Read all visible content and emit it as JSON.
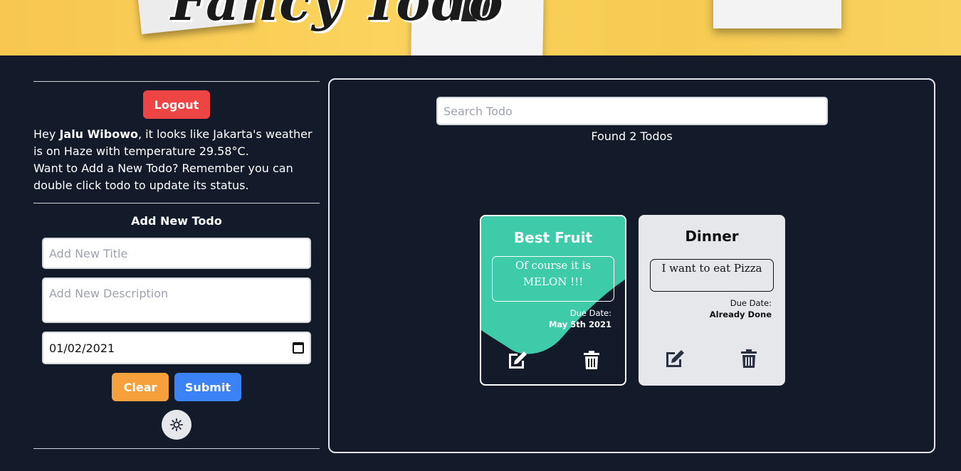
{
  "banner": {
    "title": "Fancy Todo"
  },
  "left": {
    "logout_label": "Logout",
    "greeting": {
      "prefix": "Hey ",
      "user": "Jalu Wibowo",
      "weather_text": ", it looks like Jakarta's weather is on Haze with temperature 29.58°C.",
      "hint": "Want to Add a New Todo? Remember you can double click todo to update its status."
    },
    "add_title": "Add New Todo",
    "form": {
      "title_placeholder": "Add New Title",
      "desc_placeholder": "Add New Description",
      "date_value": "01/02/2021"
    },
    "clear_label": "Clear",
    "submit_label": "Submit",
    "theme_icon": "sun-icon"
  },
  "main": {
    "search_placeholder": "Search Todo",
    "found_text": "Found 2 Todos",
    "todos": [
      {
        "title": "Best Fruit",
        "description": "Of course it is MELON !!!",
        "due_label": "Due Date:",
        "due_value": "May 5th 2021",
        "accent": "#3ecba9"
      },
      {
        "title": "Dinner",
        "description": "I want to eat Pizza",
        "due_label": "Due Date:",
        "due_value": "Already Done",
        "accent": "#e5e7eb"
      }
    ]
  },
  "colors": {
    "background": "#131a2a",
    "logout": "#ef4444",
    "clear": "#f6a03b",
    "submit": "#3b82f6",
    "banner": "#f7c74f"
  }
}
